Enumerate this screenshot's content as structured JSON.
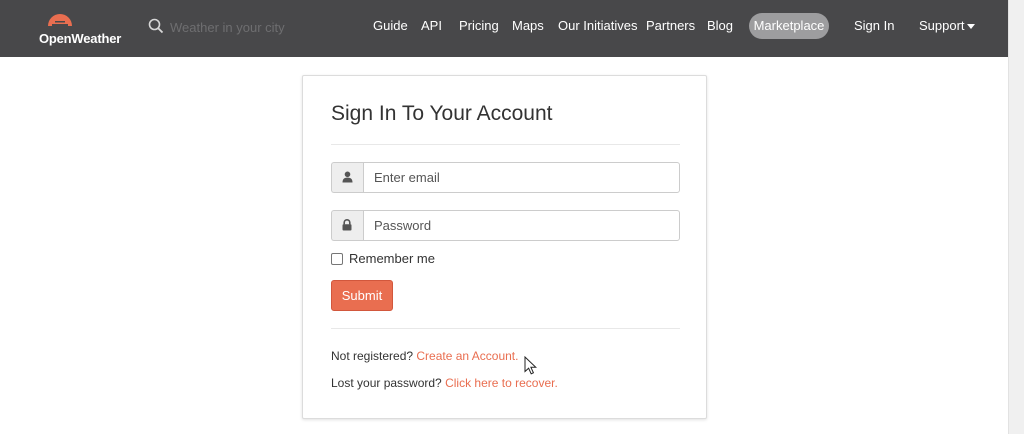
{
  "brand": {
    "name": "OpenWeather",
    "accent": "#e96e50",
    "navbar_bg": "#48484a"
  },
  "search": {
    "placeholder": "Weather in your city"
  },
  "nav": {
    "guide": "Guide",
    "api": "API",
    "pricing": "Pricing",
    "maps": "Maps",
    "initiatives": "Our Initiatives",
    "partners": "Partners",
    "blog": "Blog",
    "marketplace": "Marketplace",
    "sign_in": "Sign In",
    "support": "Support"
  },
  "form": {
    "title": "Sign In To Your Account",
    "email_placeholder": "Enter email",
    "password_placeholder": "Password",
    "remember_label": "Remember me",
    "remember_checked": false,
    "submit_label": "Submit",
    "not_registered_text": "Not registered?",
    "create_account_link": "Create an Account.",
    "lost_password_text": "Lost your password?",
    "recover_link": "Click here to recover."
  },
  "icons": {
    "search": "search-icon",
    "user": "user-icon",
    "lock": "lock-icon",
    "caret": "chevron-down-icon",
    "cursor": "mouse-cursor-icon"
  }
}
